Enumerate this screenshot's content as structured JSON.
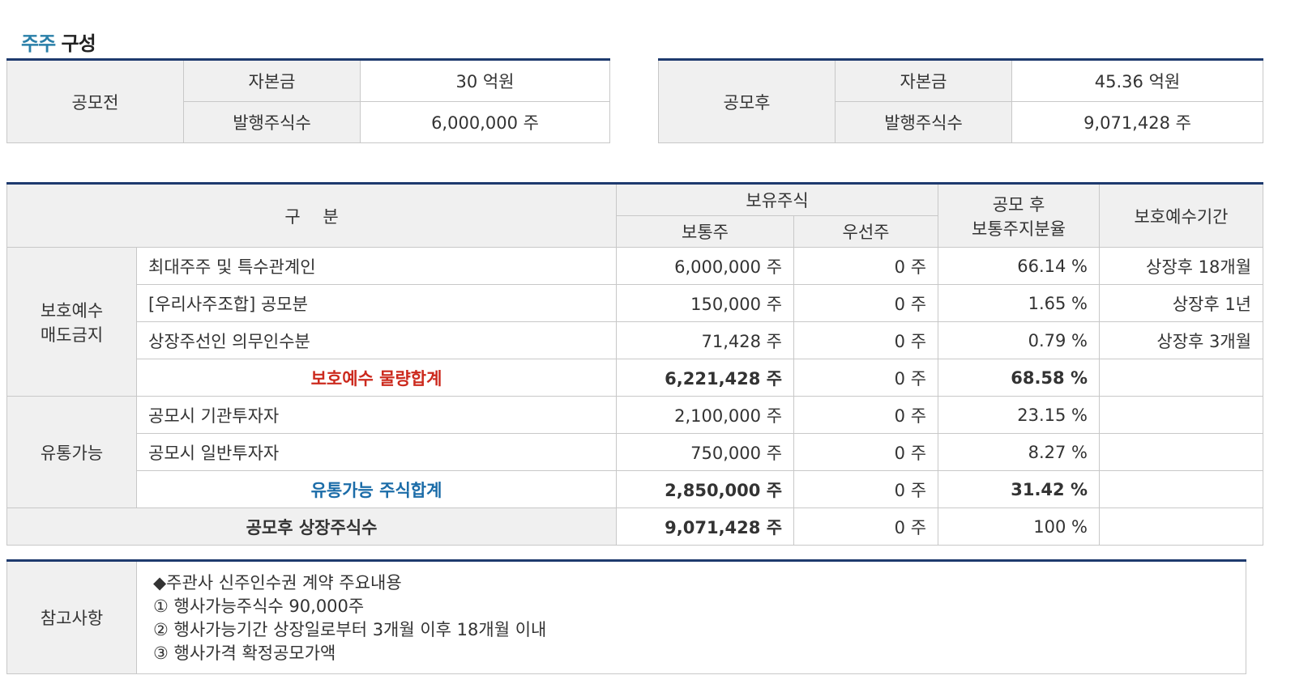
{
  "title": {
    "highlight": "주주",
    "rest": "구성"
  },
  "before": {
    "label": "공모전",
    "rows": [
      {
        "key": "자본금",
        "value": "30 억원"
      },
      {
        "key": "발행주식수",
        "value": "6,000,000 주"
      }
    ]
  },
  "after": {
    "label": "공모후",
    "rows": [
      {
        "key": "자본금",
        "value": "45.36 억원"
      },
      {
        "key": "발행주식수",
        "value": "9,071,428 주"
      }
    ]
  },
  "main": {
    "headers": {
      "division": "구　 분",
      "holding": "보유주식",
      "common": "보통주",
      "preferred": "우선주",
      "ratio_line1": "공모 후",
      "ratio_line2": "보통주지분율",
      "lockup": "보호예수기간"
    },
    "groups": {
      "protected": {
        "label_line1": "보호예수",
        "label_line2": "매도금지"
      },
      "tradable": {
        "label": "유통가능"
      }
    },
    "rows": [
      {
        "name": "최대주주 및 특수관계인",
        "common": "6,000,000 주",
        "preferred": "0 주",
        "ratio": "66.14 %",
        "period": "상장후 18개월"
      },
      {
        "name": "[우리사주조합] 공모분",
        "common": "150,000 주",
        "preferred": "0 주",
        "ratio": "1.65 %",
        "period": "상장후 1년"
      },
      {
        "name": "상장주선인 의무인수분",
        "common": "71,428 주",
        "preferred": "0 주",
        "ratio": "0.79 %",
        "period": "상장후 3개월"
      },
      {
        "name": "보호예수 물량합계",
        "common": "6,221,428 주",
        "preferred": "0 주",
        "ratio": "68.58 %",
        "period": ""
      },
      {
        "name": "공모시 기관투자자",
        "common": "2,100,000 주",
        "preferred": "0 주",
        "ratio": "23.15 %",
        "period": ""
      },
      {
        "name": "공모시 일반투자자",
        "common": "750,000 주",
        "preferred": "0 주",
        "ratio": "8.27 %",
        "period": ""
      },
      {
        "name": "유통가능 주식합계",
        "common": "2,850,000 주",
        "preferred": "0 주",
        "ratio": "31.42 %",
        "period": ""
      },
      {
        "name": "공모후 상장주식수",
        "common": "9,071,428 주",
        "preferred": "0 주",
        "ratio": "100 %",
        "period": ""
      }
    ]
  },
  "notes": {
    "label": "참고사항",
    "lines": [
      "◆주관사 신주인수권 계약 주요내용",
      "① 행사가능주식수 90,000주",
      "② 행사가능기간 상장일로부터 3개월 이후 18개월 이내",
      "③ 행사가격 확정공모가액"
    ]
  },
  "colors": {
    "accent": "#1e3a6e",
    "title_highlight": "#2a7fa8",
    "red_total": "#cc2a1e",
    "blue_total": "#1b6ca8",
    "header_bg": "#f0f0f0"
  }
}
